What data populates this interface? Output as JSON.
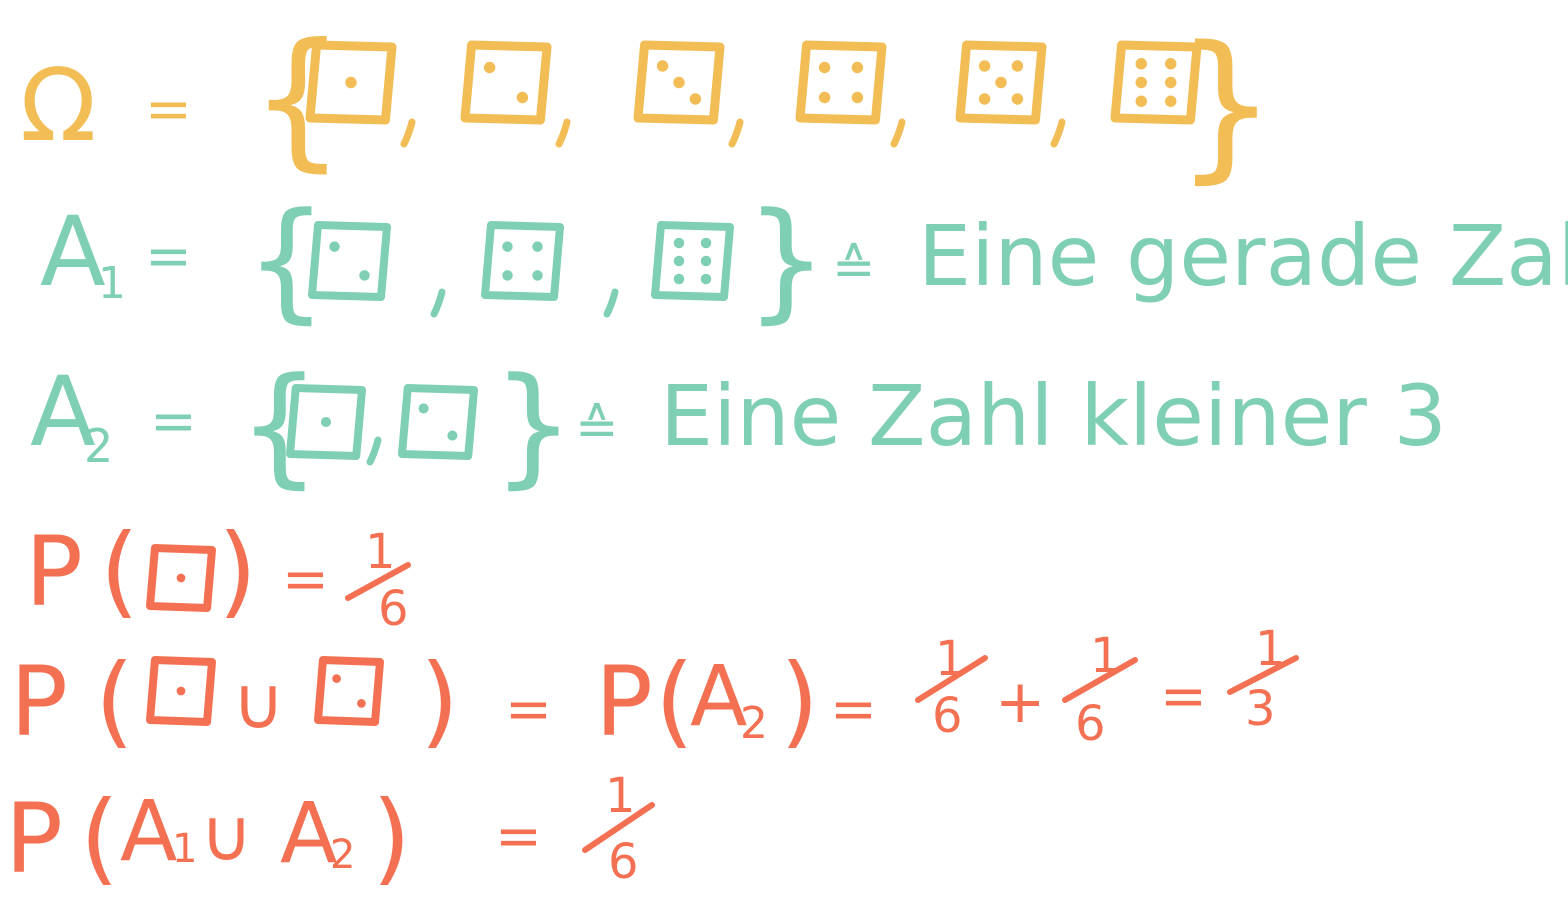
{
  "colors": {
    "omega": "#f2bd55",
    "events": "#7fcfb5",
    "probability": "#f47052",
    "background": "#ffffff"
  },
  "line_omega": {
    "symbol": "Ω",
    "equals": "=",
    "dice": [
      1,
      2,
      3,
      4,
      5,
      6
    ]
  },
  "line_a1": {
    "symbol": "A",
    "subscript": "1",
    "equals": "=",
    "dice": [
      2,
      4,
      6
    ],
    "corresponds": "≙",
    "description": "Eine gerade Zahl"
  },
  "line_a2": {
    "symbol": "A",
    "subscript": "2",
    "equals": "=",
    "dice": [
      1,
      2
    ],
    "corresponds": "≙",
    "description": "Eine Zahl kleiner 3"
  },
  "line_p1": {
    "prefix": "P",
    "die": 1,
    "equals": "=",
    "numerator": "1",
    "denominator": "6"
  },
  "line_p2": {
    "prefix": "P",
    "dice": [
      1,
      2
    ],
    "union": "∪",
    "equals": "=",
    "event_symbol": "A",
    "event_subscript": "2",
    "term1_num": "1",
    "term1_den": "6",
    "plus": "+",
    "term2_num": "1",
    "term2_den": "6",
    "result_num": "1",
    "result_den": "3"
  },
  "line_p3": {
    "prefix": "P",
    "a_symbol": "A",
    "a_sub1": "1",
    "union": "∪",
    "a_sub2": "2",
    "equals": "=",
    "numerator": "1",
    "denominator": "6"
  }
}
